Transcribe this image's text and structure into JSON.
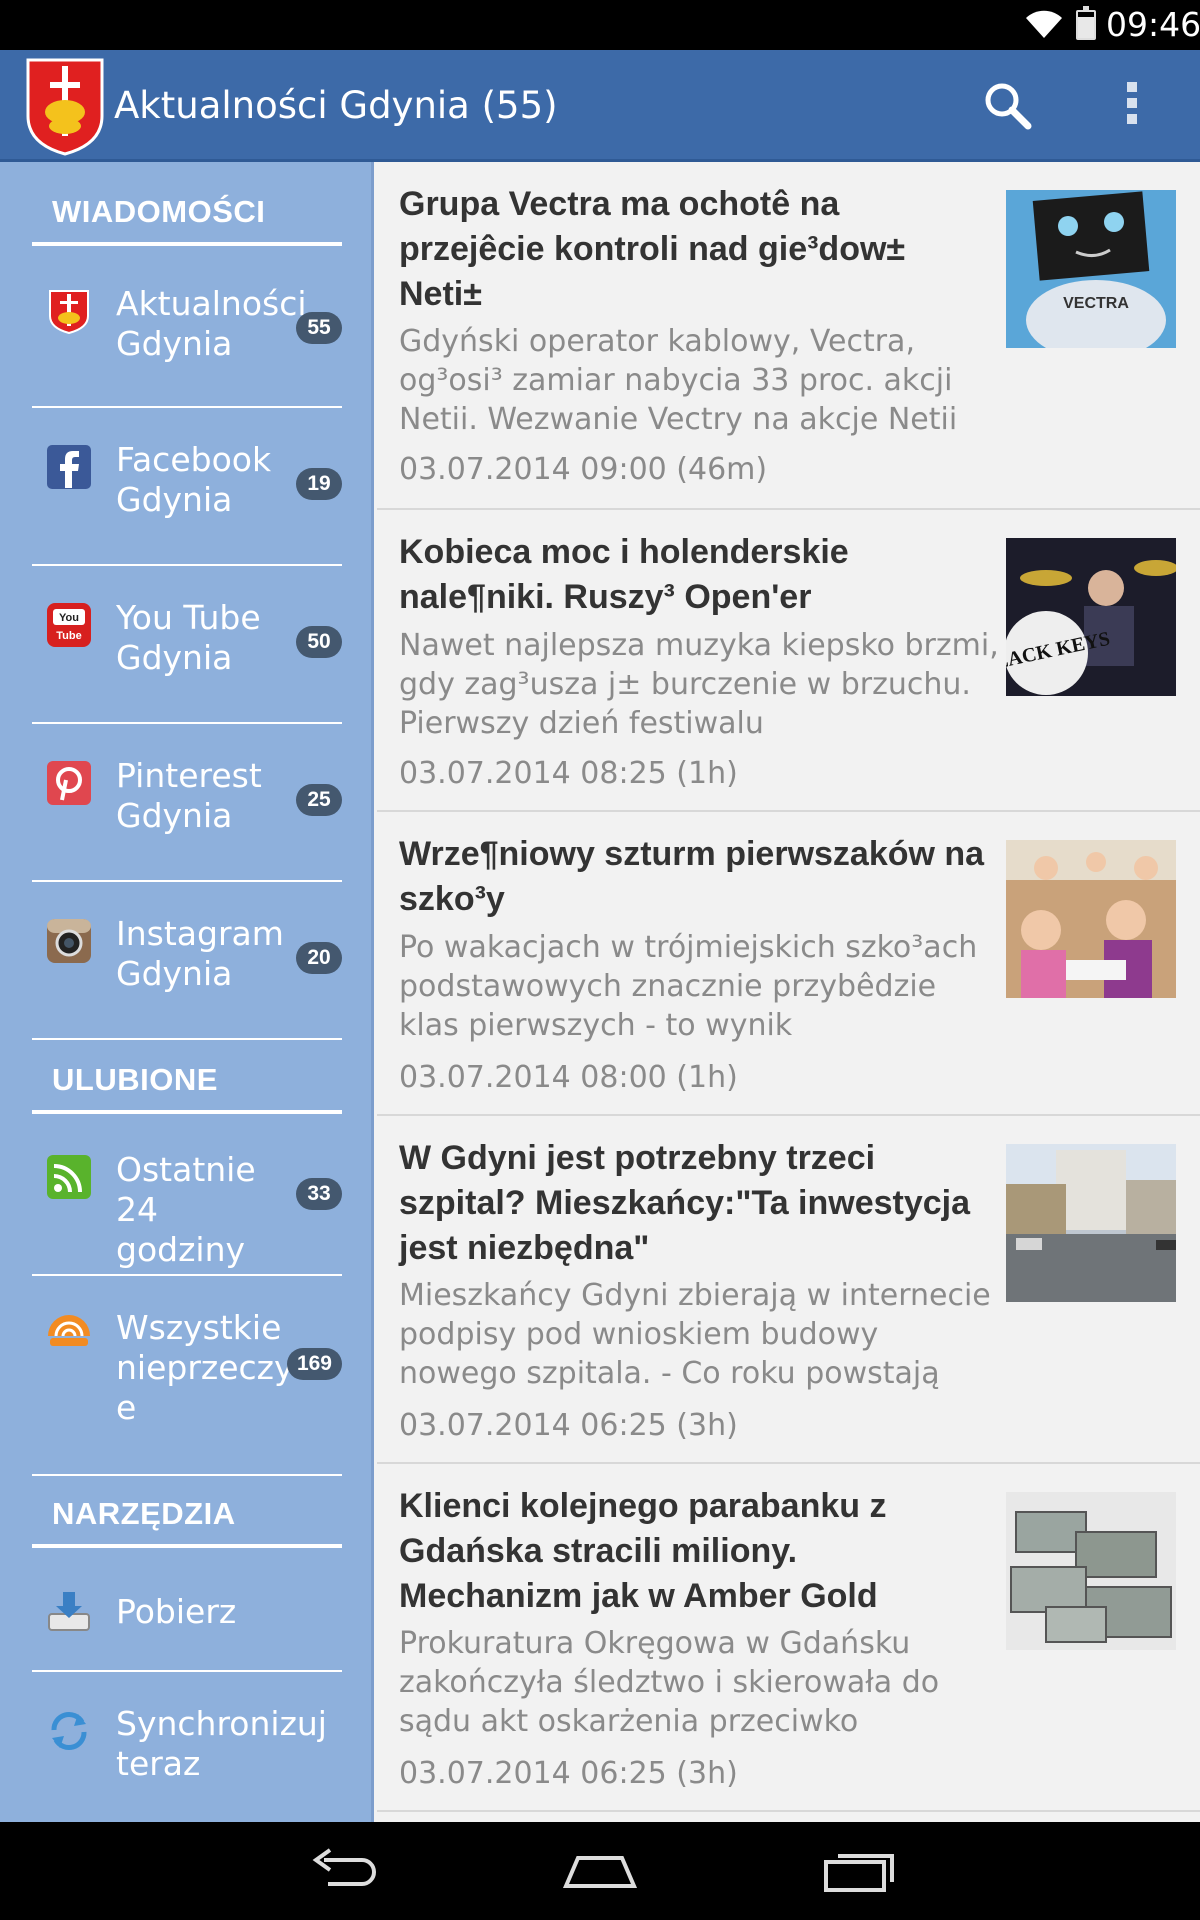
{
  "status_bar": {
    "time": "09:46"
  },
  "action_bar": {
    "title": "Aktualności Gdynia (55)",
    "icons": [
      "gdynia-crest-icon",
      "search-icon",
      "overflow-menu-icon"
    ]
  },
  "sidebar": {
    "sections": [
      {
        "header": "WIADOMOŚCI",
        "items": [
          {
            "label": "Aktualności Gdynia",
            "count": "55",
            "icon": "gdynia-crest-icon"
          },
          {
            "label": "Facebook Gdynia",
            "count": "19",
            "icon": "facebook-icon"
          },
          {
            "label": "You Tube Gdynia",
            "count": "50",
            "icon": "youtube-icon"
          },
          {
            "label": "Pinterest Gdynia",
            "count": "25",
            "icon": "pinterest-icon"
          },
          {
            "label": "Instagram Gdynia",
            "count": "20",
            "icon": "instagram-icon"
          }
        ]
      },
      {
        "header": "ULUBIONE",
        "items": [
          {
            "label": "Ostatnie 24 godziny",
            "count": "33",
            "icon": "rss-icon"
          },
          {
            "label": "Wszystkie nieprzeczyt e",
            "count": "169",
            "icon": "unread-feed-icon"
          }
        ]
      },
      {
        "header": "NARZĘDZIA",
        "items": [
          {
            "label": "Pobierz",
            "icon": "download-icon"
          },
          {
            "label": "Synchronizuj teraz",
            "icon": "sync-icon"
          }
        ]
      }
    ]
  },
  "articles": [
    {
      "title": "Grupa Vectra ma ochotê na przejêcie kontroli nad gie³dow± Neti±",
      "description": "Gdyński operator kablowy, Vectra, og³osi³ zamiar nabycia 33 proc. akcji Netii. Wezwanie Vectry na akcje Netii",
      "date": "03.07.2014 09:00 (46m)"
    },
    {
      "title": "Kobieca moc i holenderskie nale¶niki. Ruszy³ Open'er",
      "description": "Nawet najlepsza muzyka kiepsko brzmi, gdy zag³usza j± burczenie w brzuchu. Pierwszy dzień festiwalu",
      "date": "03.07.2014 08:25 (1h)"
    },
    {
      "title": "Wrze¶niowy szturm pierwszaków na szko³y",
      "description": "Po wakacjach w trójmiejskich szko³ach podstawowych znacznie przybêdzie klas pierwszych - to wynik",
      "date": "03.07.2014 08:00 (1h)"
    },
    {
      "title": "W Gdyni jest potrzebny trzeci szpital? Mieszkańcy:\"Ta inwestycja jest niezbędna\"",
      "description": "Mieszkańcy Gdyni zbierają w internecie podpisy pod wnioskiem budowy nowego szpitala. - Co roku powstają",
      "date": "03.07.2014 06:25 (3h)"
    },
    {
      "title": "Klienci kolejnego parabanku z Gdańska stracili miliony. Mechanizm jak w Amber Gold",
      "description": "Prokuratura Okręgowa w Gdańsku zakończyła śledztwo i skierowała do sądu akt oskarżenia przeciwko",
      "date": "03.07.2014 06:25 (3h)"
    }
  ],
  "nav_bar": {
    "icons": [
      "back-icon",
      "home-icon",
      "recent-apps-icon"
    ]
  }
}
